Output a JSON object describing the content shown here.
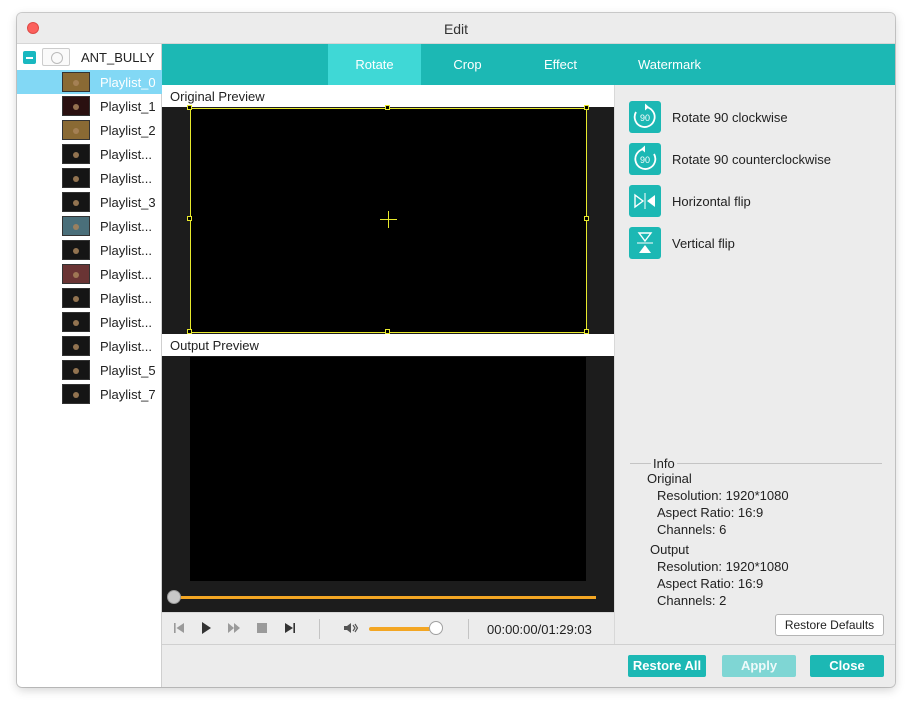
{
  "window": {
    "title": "Edit"
  },
  "sidebar": {
    "root": {
      "label": "ANT_BULLY"
    },
    "items": [
      {
        "label": "Playlist_0",
        "thumb": "warm",
        "selected": true
      },
      {
        "label": "Playlist_1",
        "thumb": "red"
      },
      {
        "label": "Playlist_2",
        "thumb": "warm"
      },
      {
        "label": "Playlist...",
        "thumb": "dark"
      },
      {
        "label": "Playlist...",
        "thumb": "dark"
      },
      {
        "label": "Playlist_3",
        "thumb": "dark"
      },
      {
        "label": "Playlist...",
        "thumb": "blue"
      },
      {
        "label": "Playlist...",
        "thumb": "dark"
      },
      {
        "label": "Playlist...",
        "thumb": "room"
      },
      {
        "label": "Playlist...",
        "thumb": "dark"
      },
      {
        "label": "Playlist...",
        "thumb": "dark"
      },
      {
        "label": "Playlist...",
        "thumb": "dark"
      },
      {
        "label": "Playlist_5",
        "thumb": "dark"
      },
      {
        "label": "Playlist_7",
        "thumb": "dark"
      }
    ]
  },
  "tabs": [
    {
      "label": "Rotate",
      "active": true
    },
    {
      "label": "Crop"
    },
    {
      "label": "Effect"
    },
    {
      "label": "Watermark"
    }
  ],
  "preview": {
    "original_label": "Original Preview",
    "output_label": "Output Preview"
  },
  "player": {
    "time": "00:00:00/01:29:03",
    "seek_progress": 0.0,
    "volume_level": 0.9
  },
  "rotate_actions": [
    {
      "label": "Rotate 90 clockwise",
      "icon": "rotate-cw-icon",
      "glyph_text": "90"
    },
    {
      "label": "Rotate 90 counterclockwise",
      "icon": "rotate-ccw-icon",
      "glyph_text": "90"
    },
    {
      "label": "Horizontal flip",
      "icon": "flip-horizontal-icon"
    },
    {
      "label": "Vertical flip",
      "icon": "flip-vertical-icon"
    }
  ],
  "info": {
    "title": "Info",
    "original": {
      "heading": "Original",
      "resolution": "Resolution: 1920*1080",
      "aspect": "Aspect Ratio: 16:9",
      "channels": "Channels: 6"
    },
    "output": {
      "heading": "Output",
      "resolution": "Resolution: 1920*1080",
      "aspect": "Aspect Ratio: 16:9",
      "channels": "Channels: 2"
    }
  },
  "buttons": {
    "restore_defaults": "Restore Defaults",
    "restore_all": "Restore All",
    "apply": "Apply",
    "close": "Close"
  },
  "colors": {
    "accent": "#1cb8b4",
    "accent_active_tab": "#3fd8d6",
    "selection": "#82d8f5",
    "progress": "#f3a623",
    "crop_frame": "#e7e92c"
  }
}
